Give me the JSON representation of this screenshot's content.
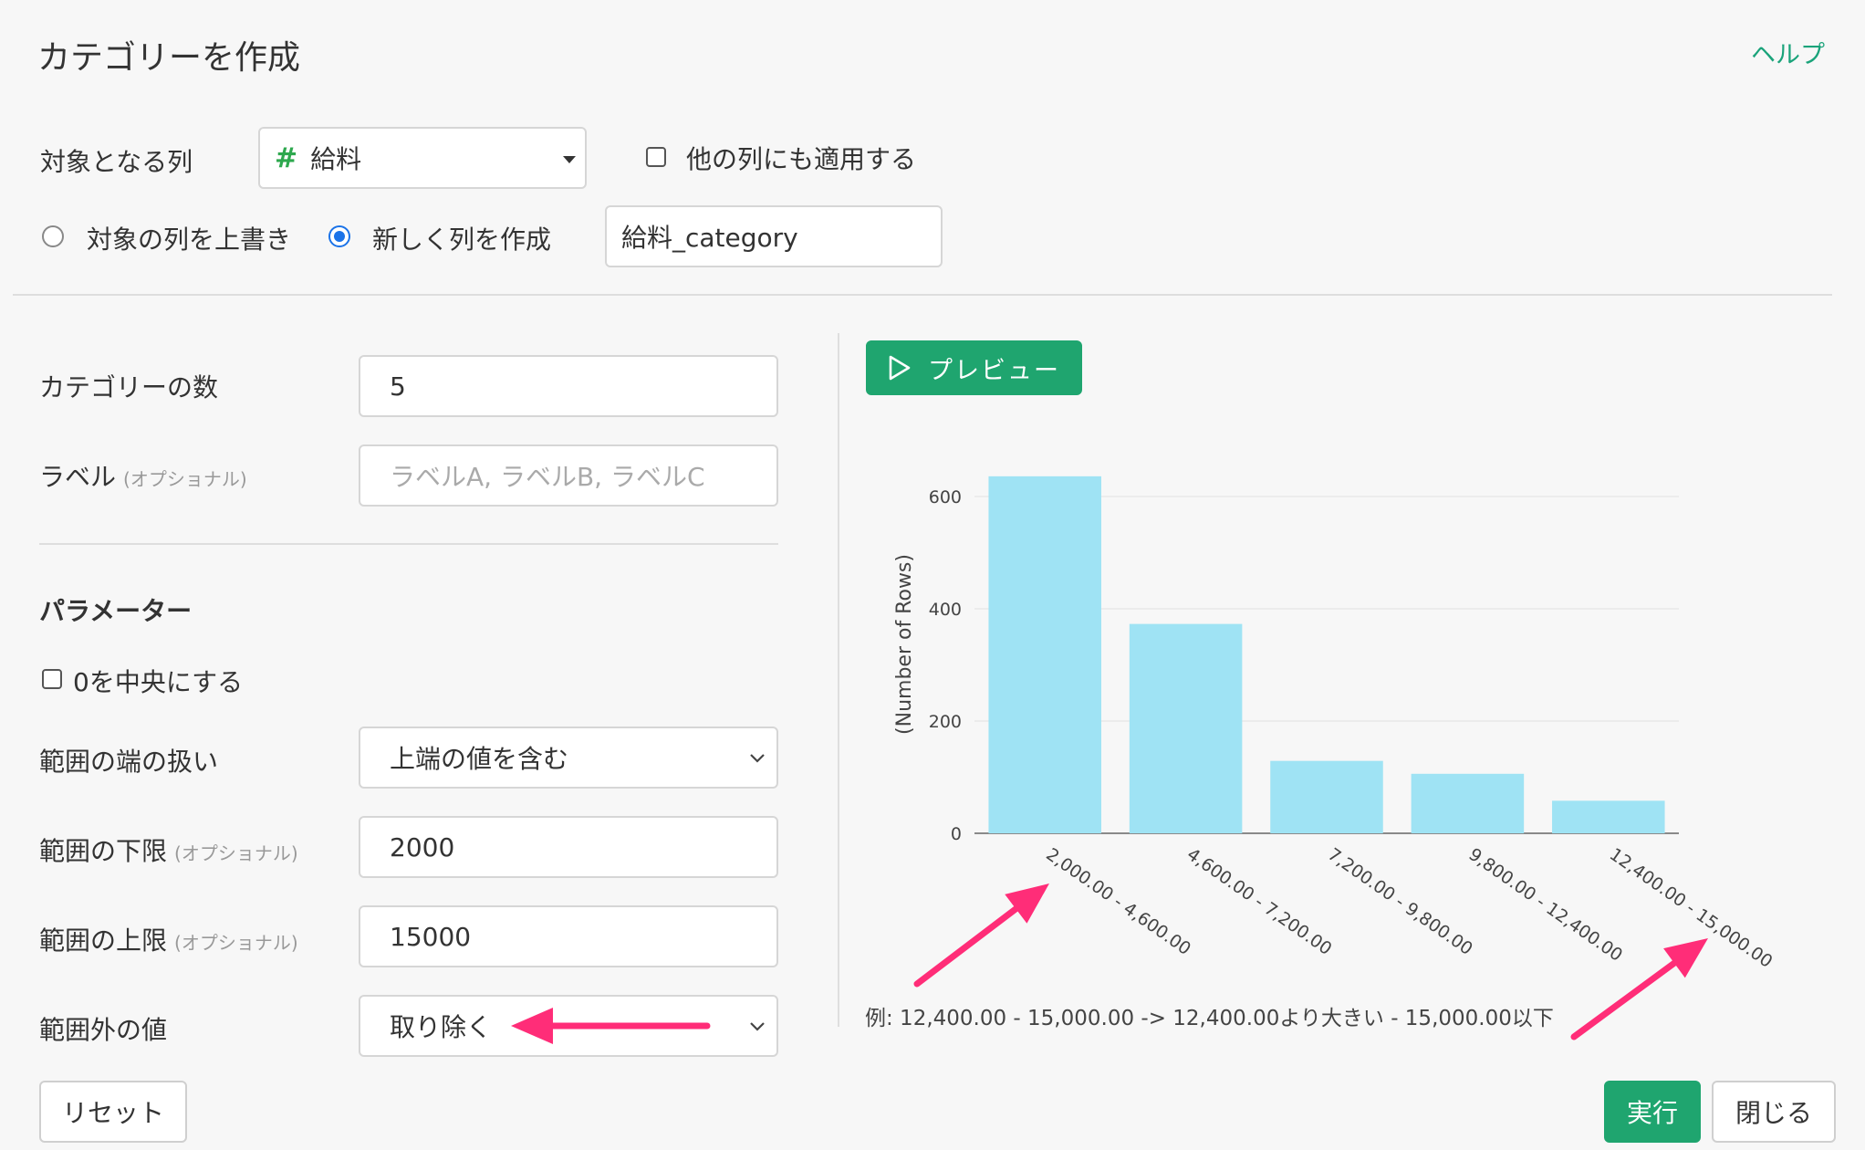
{
  "header": {
    "title": "カテゴリーを作成",
    "help": "ヘルプ"
  },
  "target": {
    "label": "対象となる列",
    "column_icon": "#",
    "column_value": "給料",
    "apply_other": "他の列にも適用する",
    "apply_other_checked": false
  },
  "output": {
    "overwrite_label": "対象の列を上書き",
    "new_column_label": "新しく列を作成",
    "selected": "new",
    "new_column_name": "給料_category"
  },
  "form": {
    "num_categories_label": "カテゴリーの数",
    "num_categories_value": "5",
    "labels_label": "ラベル",
    "labels_optional": "(オプショナル)",
    "labels_placeholder": "ラベルA, ラベルB, ラベルC",
    "params_title": "パラメーター",
    "center_zero_label": "0を中央にする",
    "center_zero_checked": false,
    "edge_label": "範囲の端の扱い",
    "edge_value": "上端の値を含む",
    "lower_label": "範囲の下限",
    "lower_optional": "(オプショナル)",
    "lower_value": "2000",
    "upper_label": "範囲の上限",
    "upper_optional": "(オプショナル)",
    "upper_value": "15000",
    "outside_label": "範囲外の値",
    "outside_value": "取り除く"
  },
  "preview_button": "プレビュー",
  "chart_data": {
    "type": "bar",
    "ylabel": "(Number of Rows)",
    "categories": [
      "2,000.00 - 4,600.00",
      "4,600.00 - 7,200.00",
      "7,200.00 - 9,800.00",
      "9,800.00 - 12,400.00",
      "12,400.00 - 15,000.00"
    ],
    "values": [
      636,
      373,
      129,
      106,
      58
    ],
    "ylim": [
      0,
      600
    ],
    "yticks": [
      0,
      200,
      400,
      600
    ],
    "bar_color": "#9fe3f4",
    "grid": true
  },
  "example_text": "例: 12,400.00 - 15,000.00 -> 12,400.00より大きい - 15,000.00以下",
  "footer": {
    "reset": "リセット",
    "run": "実行",
    "close": "閉じる"
  },
  "annotation_color": "#ff2d78"
}
